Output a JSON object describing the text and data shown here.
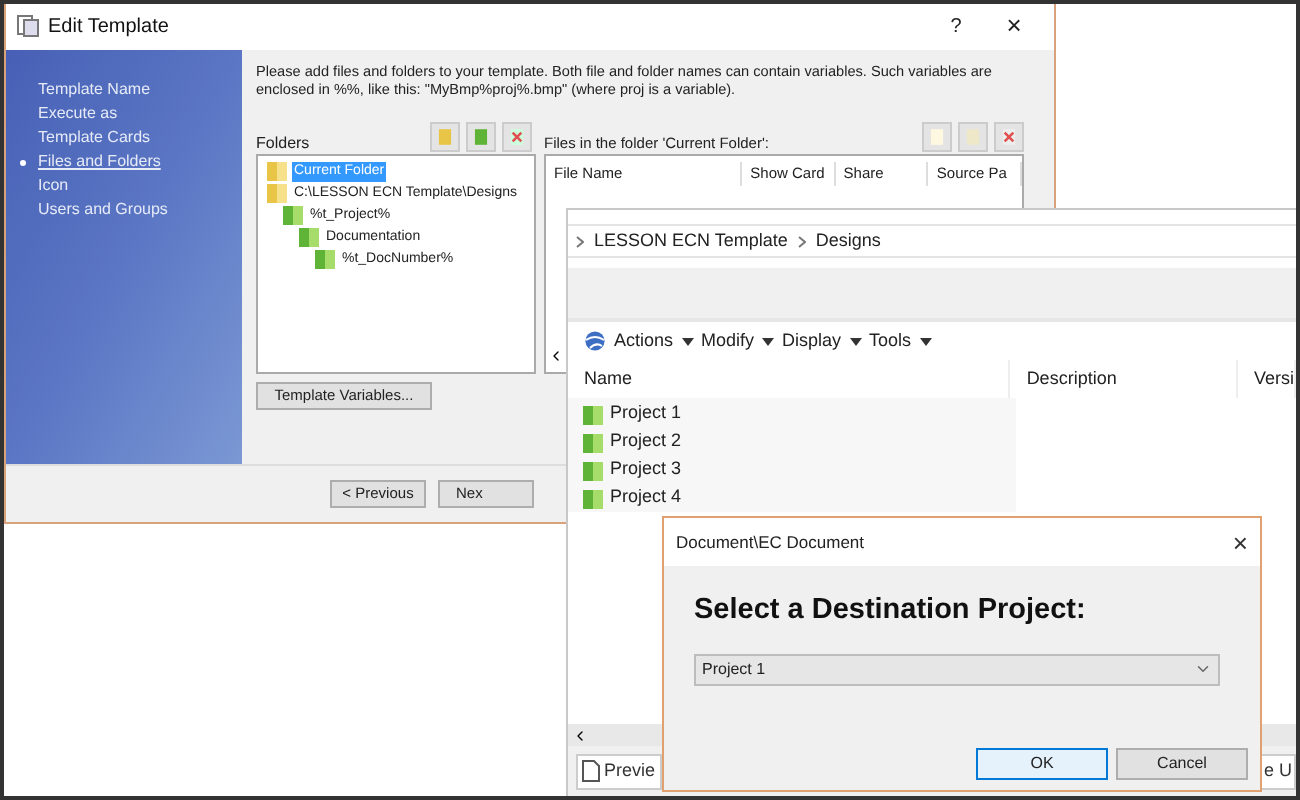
{
  "edit_template": {
    "title": "Edit Template",
    "help": "?",
    "close": "×",
    "sidebar": [
      {
        "label": "Template Name",
        "selected": false
      },
      {
        "label": "Execute as",
        "selected": false
      },
      {
        "label": "Template Cards",
        "selected": false
      },
      {
        "label": "Files and Folders",
        "selected": true
      },
      {
        "label": "Icon",
        "selected": false
      },
      {
        "label": "Users and Groups",
        "selected": false
      }
    ],
    "instructions": "Please add files and folders to your template. Both file and folder names can contain variables. Such variables are enclosed in %%, like this: \"MyBmp%proj%.bmp\" (where proj is a variable).",
    "folders_label": "Folders",
    "tree": [
      {
        "label": "Current Folder",
        "kind": "plain",
        "selected": true
      },
      {
        "label": "C:\\LESSON ECN Template\\Designs",
        "kind": "plain",
        "selected": false,
        "children": [
          {
            "label": "%t_Project%",
            "kind": "project",
            "selected": false,
            "children": [
              {
                "label": "Documentation",
                "kind": "project",
                "selected": false,
                "children": [
                  {
                    "label": "%t_DocNumber%",
                    "kind": "project",
                    "selected": false
                  }
                ]
              }
            ]
          }
        ]
      }
    ],
    "files_label": "Files in the folder 'Current Folder':",
    "files_columns": [
      "File Name",
      "Show Card",
      "Share",
      "Source Pa"
    ],
    "template_variables_button": "Template Variables...",
    "previous_button": "< Previous",
    "next_button": "Nex"
  },
  "explorer": {
    "breadcrumb": [
      "LESSON ECN Template",
      "Designs"
    ],
    "menus": [
      "Actions",
      "Modify",
      "Display",
      "Tools"
    ],
    "columns": [
      "Name",
      "Description",
      "Versi"
    ],
    "rows": [
      "Project 1",
      "Project 2",
      "Project 3",
      "Project 4"
    ],
    "preview_button": "Previe",
    "status_fragment": "e U"
  },
  "dialog": {
    "title": "Document\\EC Document",
    "close": "×",
    "heading": "Select a Destination Project:",
    "project_select": "Project 1",
    "ok": "OK",
    "cancel": "Cancel"
  }
}
